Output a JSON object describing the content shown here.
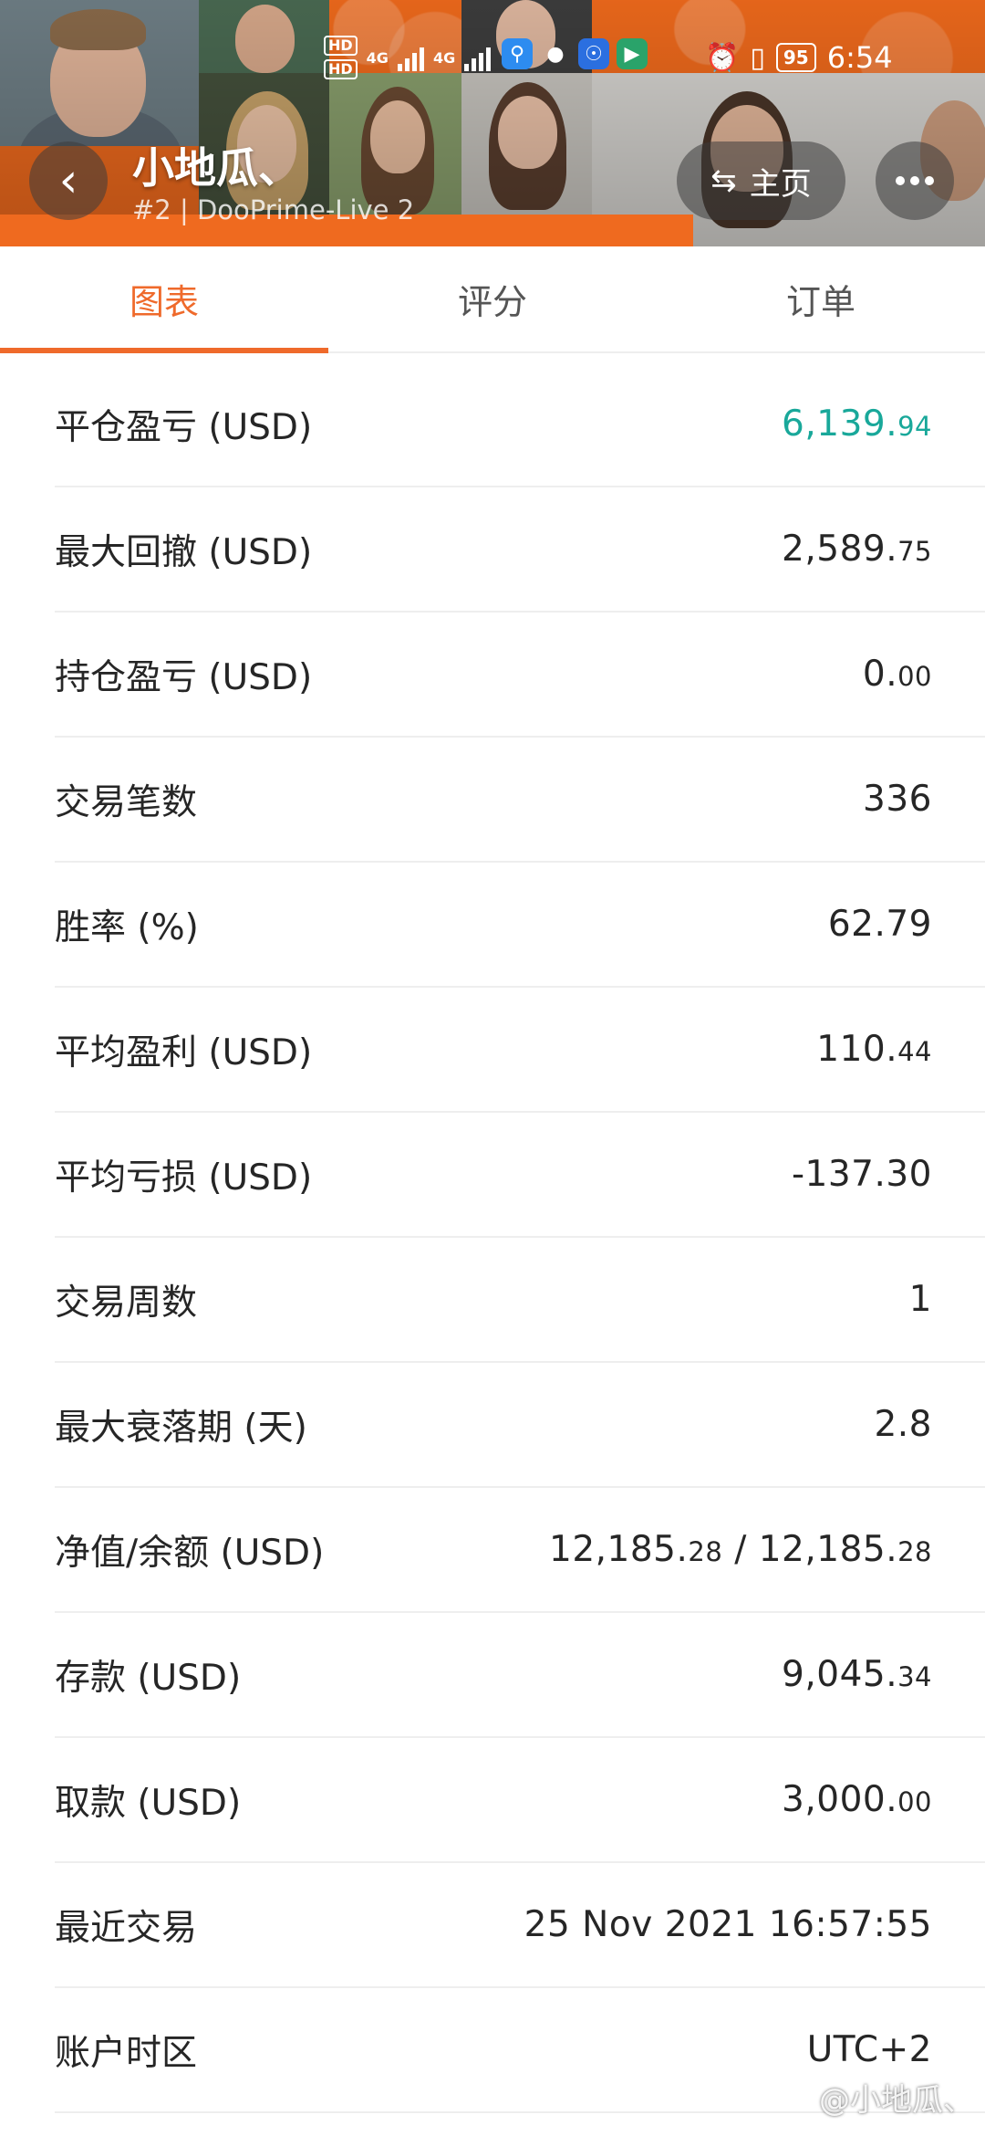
{
  "status_bar": {
    "network_1": "HD",
    "network_2": "HD",
    "network_type_1": "4G",
    "network_type_2": "4G",
    "battery": "95",
    "time": "6:54"
  },
  "header": {
    "back_icon": "chevron-left-icon",
    "name": "小地瓜、",
    "subtitle": "#2 | DooPrime-Live 2",
    "home_label": "主页",
    "home_icon": "swap-arrows-icon",
    "more_icon": "more-dots-icon"
  },
  "tabs": [
    {
      "label": "图表",
      "active": true
    },
    {
      "label": "评分",
      "active": false
    },
    {
      "label": "订单",
      "active": false
    }
  ],
  "accent_color": "#ef6a2b",
  "positive_color": "#19a89a",
  "stats": [
    {
      "label": "平仓盈亏 (USD)",
      "value_main": "6,139.",
      "value_small": "94",
      "positive": true
    },
    {
      "label": "最大回撤 (USD)",
      "value_main": "2,589.",
      "value_small": "75"
    },
    {
      "label": "持仓盈亏 (USD)",
      "value_main": "0.",
      "value_small": "00"
    },
    {
      "label": "交易笔数",
      "value_main": "336",
      "value_small": ""
    },
    {
      "label": "胜率 (%)",
      "value_main": "62.79",
      "value_small": ""
    },
    {
      "label": "平均盈利 (USD)",
      "value_main": "110.",
      "value_small": "44"
    },
    {
      "label": "平均亏损 (USD)",
      "value_main": "-137.30",
      "value_small": ""
    },
    {
      "label": "交易周数",
      "value_main": "1",
      "value_small": ""
    },
    {
      "label": "最大衰落期 (天)",
      "value_main": "2.8",
      "value_small": ""
    },
    {
      "label": "净值/余额 (USD)",
      "value_main": "12,185.",
      "value_small": "28",
      "value_main2": " / 12,185.",
      "value_small2": "28"
    },
    {
      "label": "存款 (USD)",
      "value_main": "9,045.",
      "value_small": "34"
    },
    {
      "label": "取款 (USD)",
      "value_main": "3,000.",
      "value_small": "00"
    },
    {
      "label": "最近交易",
      "value_main": "25 Nov 2021 16:57:55",
      "value_small": ""
    },
    {
      "label": "账户时区",
      "value_main": "UTC+2",
      "value_small": ""
    }
  ],
  "watermark": "@小地瓜、"
}
